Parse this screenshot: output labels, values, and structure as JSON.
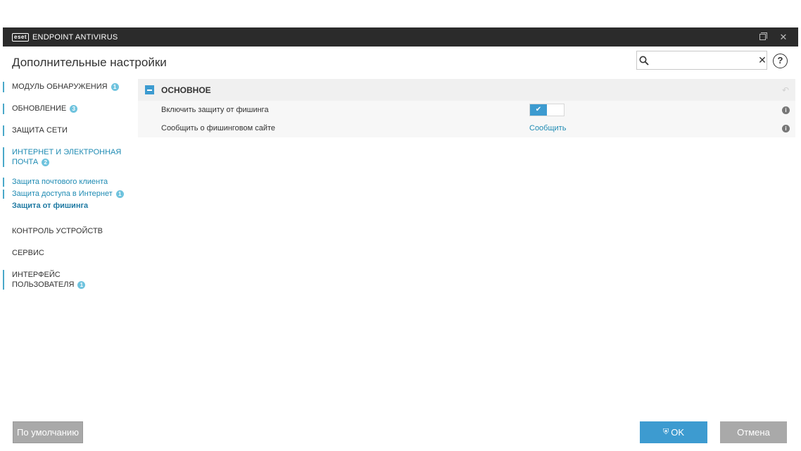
{
  "window": {
    "logo_text": "eset",
    "app_title": "ENDPOINT ANTIVIRUS"
  },
  "header": {
    "page_title": "Дополнительные настройки",
    "search_value": "",
    "search_placeholder": "",
    "help_glyph": "?"
  },
  "sidebar": {
    "items": [
      {
        "label": "МОДУЛЬ ОБНАРУЖЕНИЯ",
        "badge": "1"
      },
      {
        "label": "ОБНОВЛЕНИЕ",
        "badge": "3"
      },
      {
        "label": "ЗАЩИТА СЕТИ"
      },
      {
        "label_line1": "ИНТЕРНЕТ И ЭЛЕКТРОННАЯ",
        "label_line2": "ПОЧТА",
        "badge": "2"
      },
      {
        "label": "КОНТРОЛЬ УСТРОЙСТВ"
      },
      {
        "label": "СЕРВИС"
      },
      {
        "label_line1": "ИНТЕРФЕЙС",
        "label_line2": "ПОЛЬЗОВАТЕЛЯ",
        "badge": "1"
      }
    ],
    "subitems": [
      {
        "label": "Защита почтового клиента"
      },
      {
        "label": "Защита доступа в Интернет",
        "badge": "1"
      },
      {
        "label": "Защита от фишинга"
      }
    ]
  },
  "section": {
    "title": "ОСНОВНОЕ",
    "rows": [
      {
        "label": "Включить защиту от фишинга",
        "toggle_on": true
      },
      {
        "label": "Сообщить о фишинговом сайте",
        "link": "Сообщить"
      }
    ]
  },
  "footer": {
    "default_label": "По умолчанию",
    "ok_label": "OK",
    "cancel_label": "Отмена"
  },
  "colors": {
    "accent": "#3d9bd0",
    "titlebar": "#2b2b2b",
    "badge": "#6fc3de"
  }
}
